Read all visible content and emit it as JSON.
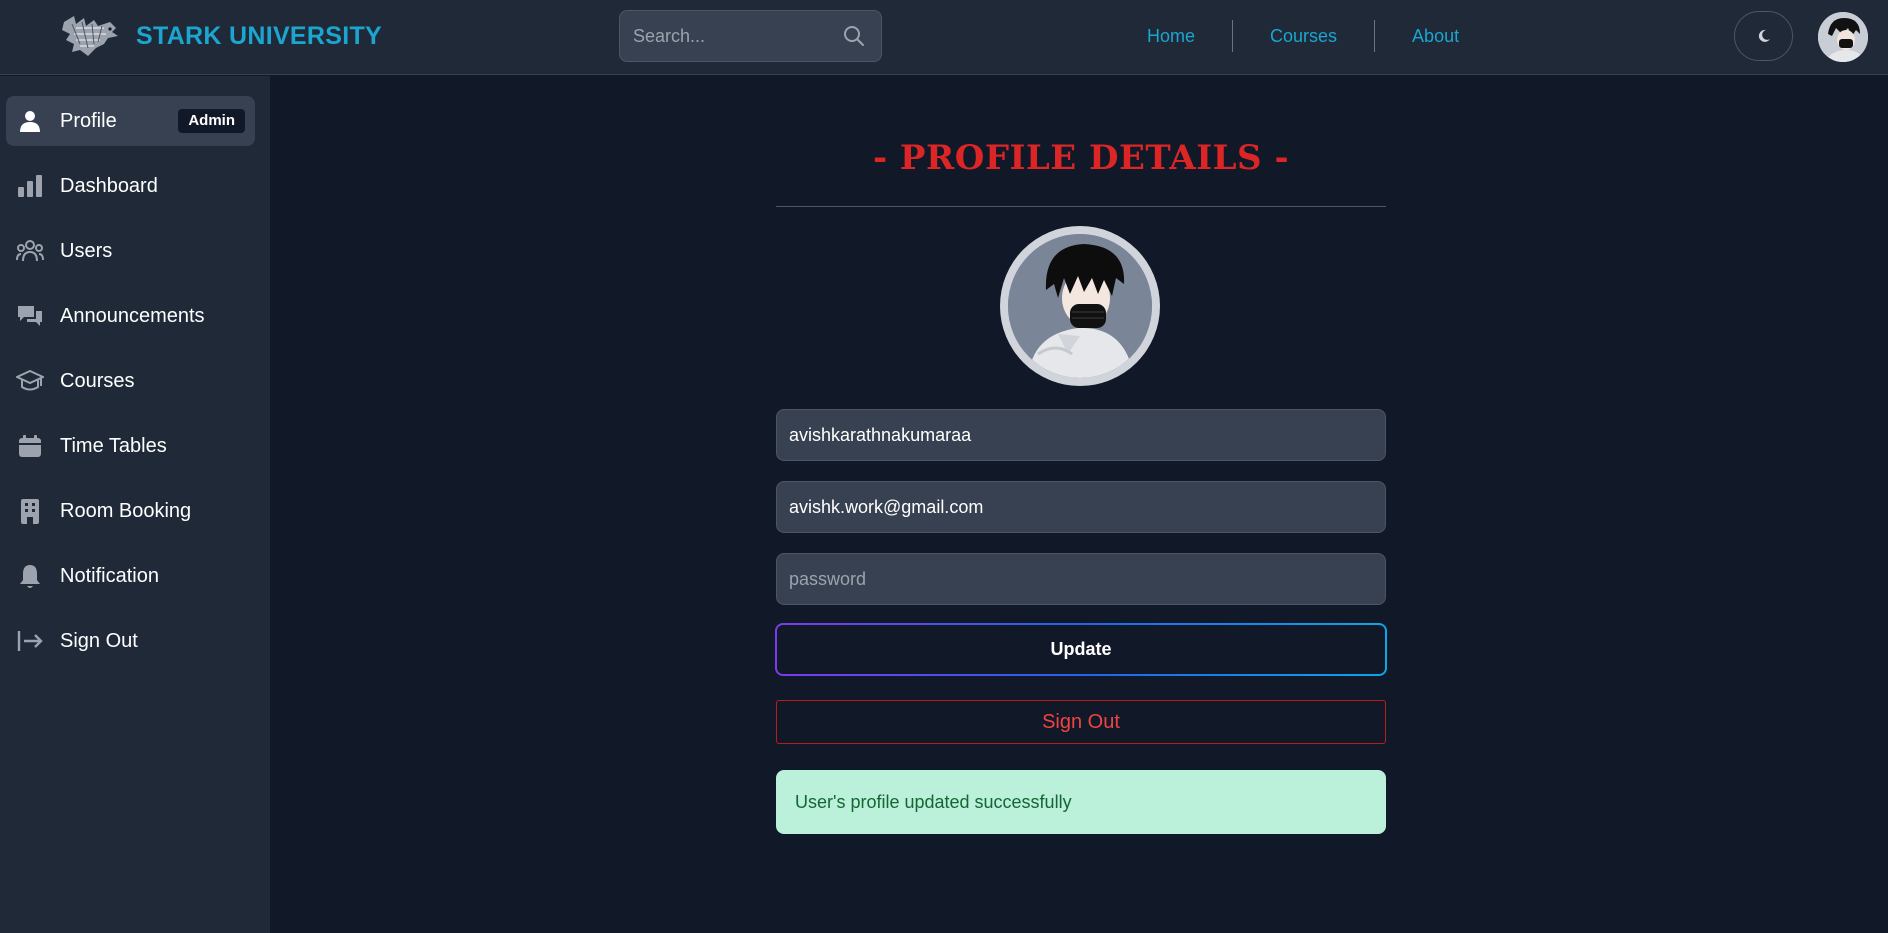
{
  "brand": {
    "name": "STARK UNIVERSITY",
    "logo": "direwolf-logo",
    "accent": "#1ba5cf"
  },
  "search": {
    "placeholder": "Search...",
    "value": ""
  },
  "nav": {
    "links": [
      {
        "label": "Home"
      },
      {
        "label": "Courses"
      },
      {
        "label": "About"
      }
    ]
  },
  "sidebar": {
    "items": [
      {
        "label": "Profile",
        "icon": "person-icon",
        "badge": "Admin",
        "active": true
      },
      {
        "label": "Dashboard",
        "icon": "bar-chart-icon"
      },
      {
        "label": "Users",
        "icon": "users-icon"
      },
      {
        "label": "Announcements",
        "icon": "chat-icon"
      },
      {
        "label": "Courses",
        "icon": "graduation-cap-icon"
      },
      {
        "label": "Time Tables",
        "icon": "calendar-icon"
      },
      {
        "label": "Room Booking",
        "icon": "building-icon"
      },
      {
        "label": "Notification",
        "icon": "bell-icon"
      },
      {
        "label": "Sign Out",
        "icon": "sign-out-icon"
      }
    ]
  },
  "main": {
    "title": "- PROFILE DETAILS -",
    "username": "avishkarathnakumaraa",
    "email": "avishk.work@gmail.com",
    "password_placeholder": "password",
    "update_label": "Update",
    "signout_label": "Sign Out",
    "alert": "User's profile updated successfully"
  },
  "colors": {
    "title": "#dc2626",
    "signout": "#ef4444",
    "alert_bg": "#bbf0da",
    "alert_text": "#166534"
  }
}
